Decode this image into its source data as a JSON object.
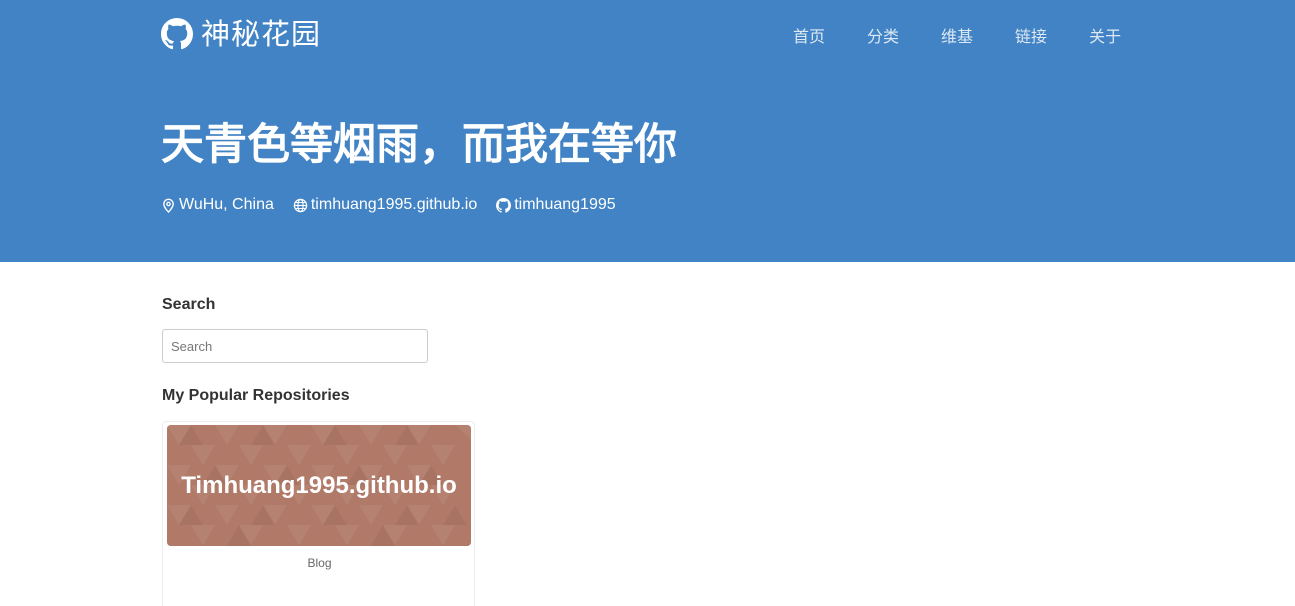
{
  "header": {
    "site_title": "神秘花园",
    "nav": [
      {
        "label": "首页"
      },
      {
        "label": "分类"
      },
      {
        "label": "维基"
      },
      {
        "label": "链接"
      },
      {
        "label": "关于"
      }
    ],
    "motto": "天青色等烟雨，而我在等你",
    "meta": {
      "location": "WuHu, China",
      "website": "timhuang1995.github.io",
      "github": "timhuang1995"
    },
    "colors": {
      "background": "#4183c4",
      "text": "#ffffff"
    }
  },
  "sidebar": {
    "search": {
      "title": "Search",
      "placeholder": "Search"
    },
    "popular_repos": {
      "title": "My Popular Repositories",
      "items": [
        {
          "name": "Timhuang1995.github.io",
          "description": "Blog",
          "thumb_color": "#b17a68"
        }
      ]
    }
  },
  "icons": {
    "brand": "github-icon",
    "location": "map-marker-icon",
    "website": "globe-icon",
    "github": "github-icon"
  }
}
